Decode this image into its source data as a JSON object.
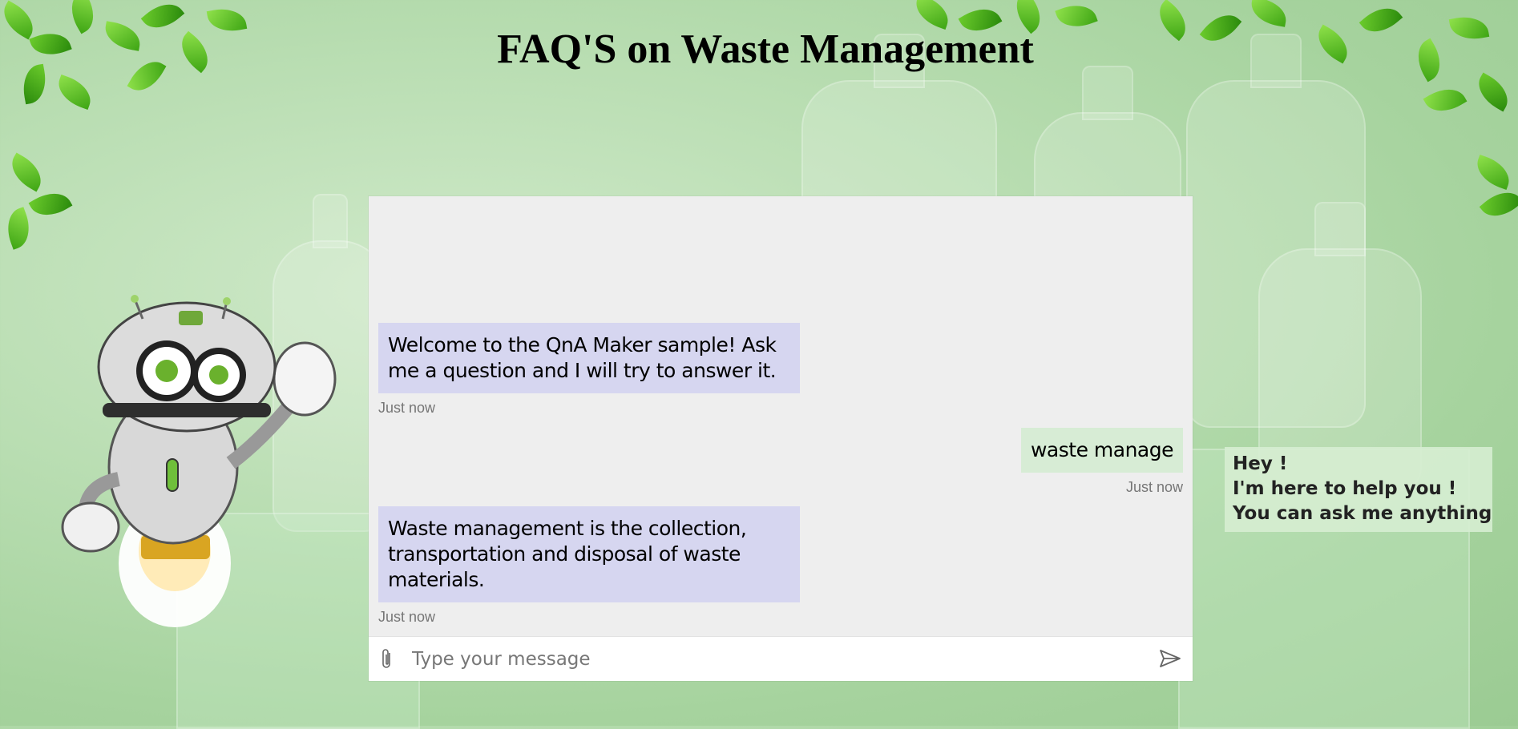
{
  "page": {
    "title": "FAQ'S on Waste Management"
  },
  "chat": {
    "messages": [
      {
        "from": "bot",
        "text": "Welcome to the QnA Maker sample! Ask me a question and I will try to answer it.",
        "time": "Just now"
      },
      {
        "from": "user",
        "text": "waste manage",
        "time": "Just now"
      },
      {
        "from": "bot",
        "text": "Waste management is the collection, transportation and disposal of waste materials.",
        "time": "Just now"
      }
    ],
    "input": {
      "placeholder": "Type your message",
      "value": ""
    },
    "attach_icon": "paperclip-icon",
    "send_icon": "send-icon"
  },
  "helper": {
    "line1": "Hey !",
    "line2": "I'm here to help you !",
    "line3": "You can ask me anything"
  },
  "colors": {
    "bot_bubble": "#d6d6f0",
    "user_bubble": "#d7ecd5",
    "panel": "#eeeeee",
    "leaf": "#5cc21e"
  }
}
